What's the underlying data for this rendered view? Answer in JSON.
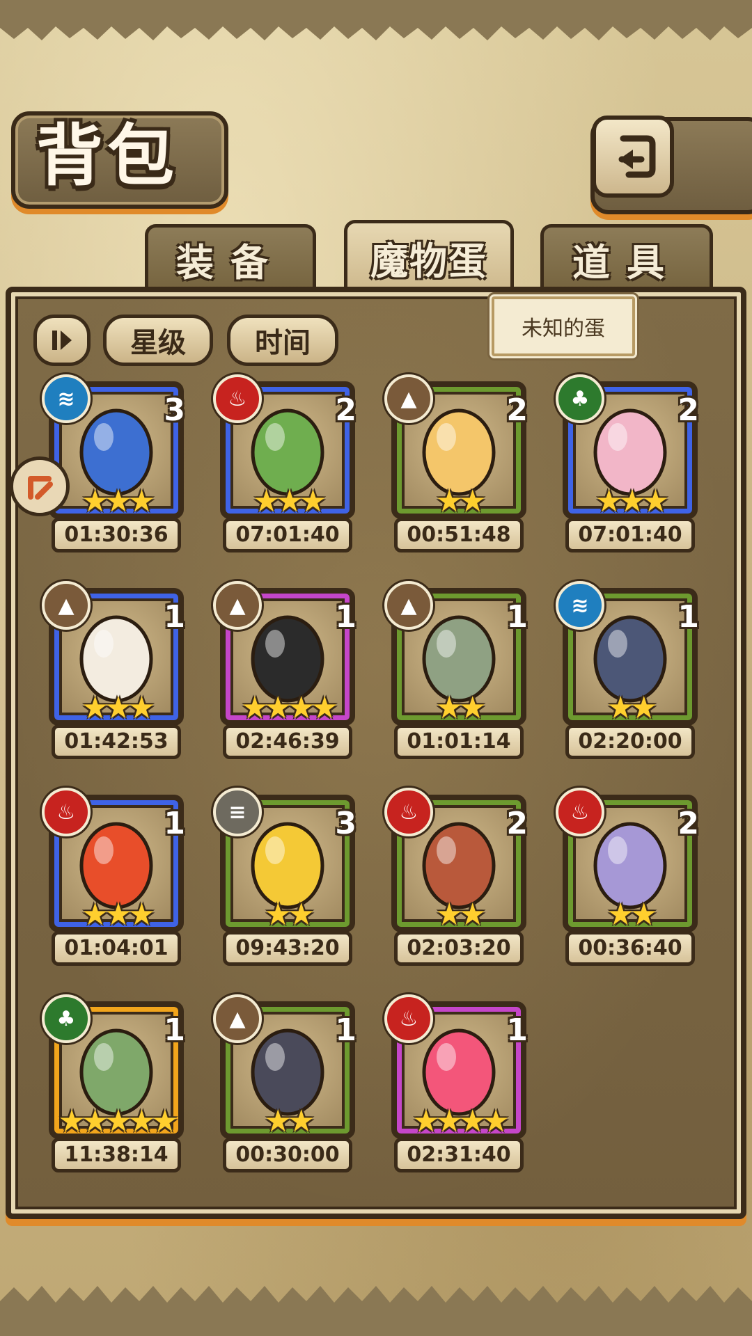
{
  "header": {
    "title": "背包"
  },
  "tabs": [
    {
      "label": "装备",
      "active": false
    },
    {
      "label": "魔物蛋",
      "active": true
    },
    {
      "label": "道具",
      "active": false
    }
  ],
  "sort": {
    "star_label": "星级",
    "time_label": "时间"
  },
  "tooltip": "未知的蛋",
  "colors": {
    "blue": "#3f63e6",
    "green": "#6d9a2f",
    "purple": "#c546c9",
    "orange": "#f2a51c"
  },
  "eggs": [
    {
      "element": "water",
      "count": "3",
      "stars": "★★★",
      "timer": "01:30:36",
      "frame": "blue"
    },
    {
      "element": "fire",
      "count": "2",
      "stars": "★★★",
      "timer": "07:01:40",
      "frame": "blue"
    },
    {
      "element": "earth",
      "count": "2",
      "stars": "★★",
      "timer": "00:51:48",
      "frame": "green"
    },
    {
      "element": "nature",
      "count": "2",
      "stars": "★★★",
      "timer": "07:01:40",
      "frame": "blue"
    },
    {
      "element": "earth",
      "count": "1",
      "stars": "★★★",
      "timer": "01:42:53",
      "frame": "blue"
    },
    {
      "element": "earth",
      "count": "1",
      "stars": "★★★★",
      "timer": "02:46:39",
      "frame": "purple"
    },
    {
      "element": "earth",
      "count": "1",
      "stars": "★★",
      "timer": "01:01:14",
      "frame": "green"
    },
    {
      "element": "water",
      "count": "1",
      "stars": "★★",
      "timer": "02:20:00",
      "frame": "green"
    },
    {
      "element": "fire",
      "count": "1",
      "stars": "★★★",
      "timer": "01:04:01",
      "frame": "blue"
    },
    {
      "element": "wind",
      "count": "3",
      "stars": "★★",
      "timer": "09:43:20",
      "frame": "green"
    },
    {
      "element": "fire",
      "count": "2",
      "stars": "★★",
      "timer": "02:03:20",
      "frame": "green"
    },
    {
      "element": "fire",
      "count": "2",
      "stars": "★★",
      "timer": "00:36:40",
      "frame": "green"
    },
    {
      "element": "nature",
      "count": "1",
      "stars": "★★★★★",
      "timer": "11:38:14",
      "frame": "orange"
    },
    {
      "element": "earth",
      "count": "1",
      "stars": "★★",
      "timer": "00:30:00",
      "frame": "green"
    },
    {
      "element": "fire",
      "count": "1",
      "stars": "★★★★",
      "timer": "02:31:40",
      "frame": "purple"
    }
  ]
}
